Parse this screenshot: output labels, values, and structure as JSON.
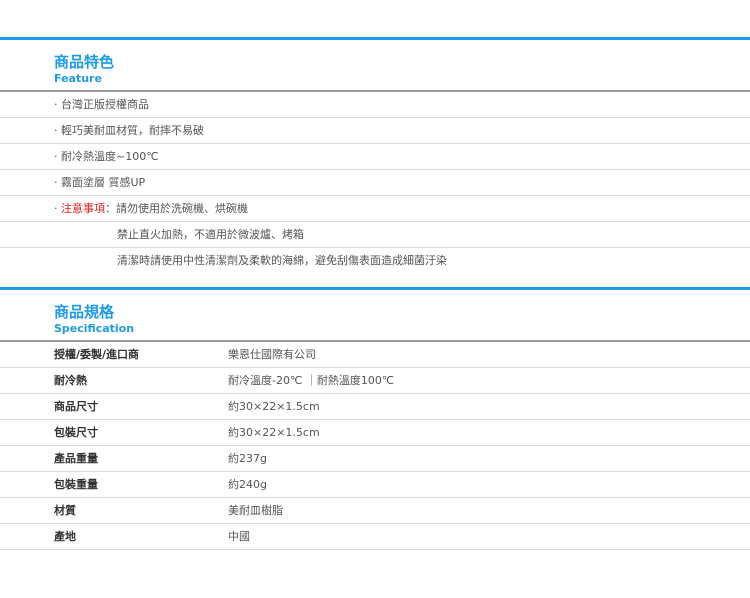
{
  "feature": {
    "title_zh": "商品特色",
    "title_en": "Feature",
    "items": [
      "· 台灣正版授權商品",
      "· 輕巧美耐皿材質，耐摔不易破",
      "· 耐冷熱溫度~100℃",
      "· 霧面塗層 質感UP"
    ],
    "notice": {
      "bullet": "· ",
      "label": "注意事項",
      "sep": "：",
      "lines": [
        "請勿使用於洗碗機、烘碗機",
        "禁止直火加熱，不適用於微波爐、烤箱",
        "清潔時請使用中性清潔劑及柔軟的海綿，避免刮傷表面造成細菌汙染"
      ]
    }
  },
  "specification": {
    "title_zh": "商品規格",
    "title_en": "Specification",
    "rows": [
      {
        "label": "授權/委製/進口商",
        "value": "樂恩仕國際有公司"
      },
      {
        "label": "耐冷熱",
        "value": "耐冷溫度-20℃ ｜耐熱溫度100℃"
      },
      {
        "label": "商品尺寸",
        "value": "約30×22×1.5cm"
      },
      {
        "label": "包裝尺寸",
        "value": "約30×22×1.5cm"
      },
      {
        "label": "產品重量",
        "value": "約237g"
      },
      {
        "label": "包裝重量",
        "value": "約240g"
      },
      {
        "label": "材質",
        "value": "美耐皿樹脂"
      },
      {
        "label": "產地",
        "value": "中國"
      }
    ]
  },
  "colors": {
    "accent": "#1e9be8",
    "warning": "#e02020",
    "text": "#555555",
    "divider": "#d9d9d9"
  }
}
